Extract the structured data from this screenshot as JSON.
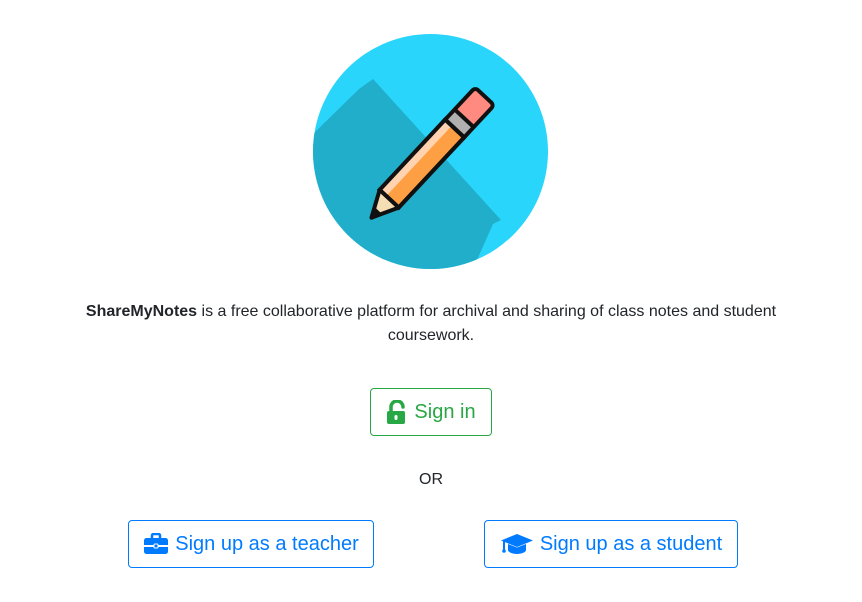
{
  "brand": {
    "name": "ShareMyNotes",
    "tagline": "is a free collaborative platform for archival and sharing of class notes and student coursework."
  },
  "icons": {
    "logo": "pencil-logo-icon",
    "signin": "unlock-icon",
    "teacher": "briefcase-icon",
    "student": "graduation-cap-icon"
  },
  "colors": {
    "logo_circle": "#29d5fb",
    "logo_shadow": "#21aecb",
    "success": "#28a745",
    "primary": "#007bff"
  },
  "actions": {
    "signin_label": "Sign in",
    "or_label": "OR",
    "teacher_label": "Sign up as a teacher",
    "student_label": "Sign up as a student"
  }
}
